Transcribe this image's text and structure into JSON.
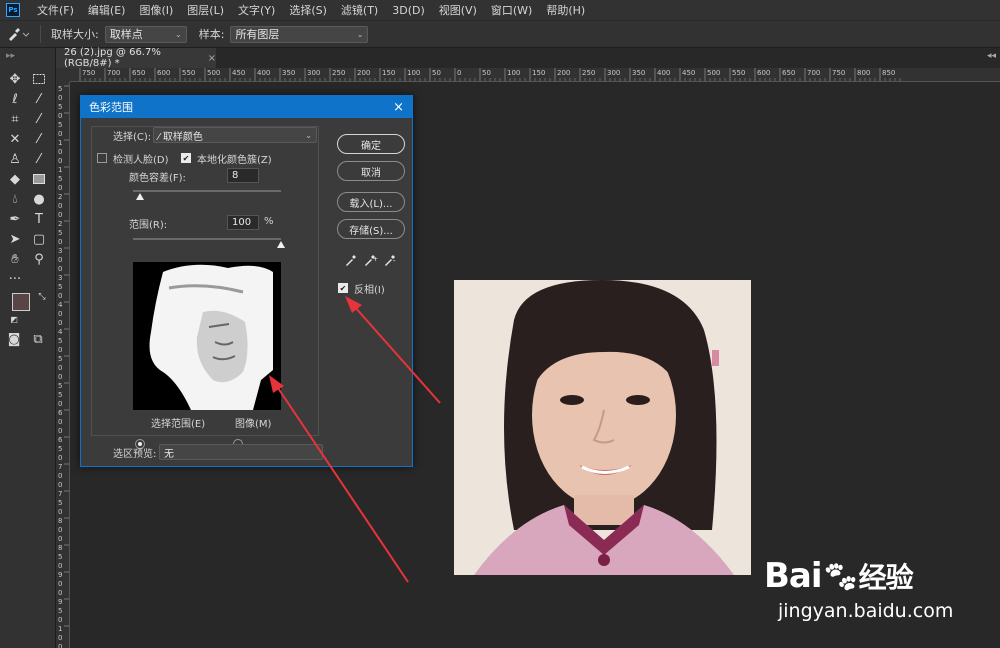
{
  "app": {
    "logo_text": "Ps"
  },
  "menu": [
    "文件(F)",
    "编辑(E)",
    "图像(I)",
    "图层(L)",
    "文字(Y)",
    "选择(S)",
    "滤镜(T)",
    "3D(D)",
    "视图(V)",
    "窗口(W)",
    "帮助(H)"
  ],
  "options": {
    "sample_size_label": "取样大小:",
    "sample_size_value": "取样点",
    "sample_label": "样本:",
    "sample_value": "所有图层"
  },
  "document": {
    "tab_title": "26 (2).jpg @ 66.7%(RGB/8#) *",
    "tab_close": "×"
  },
  "ruler": {
    "h_labels": [
      "750",
      "700",
      "650",
      "600",
      "550",
      "500",
      "450",
      "400",
      "350",
      "300",
      "250",
      "200",
      "150",
      "100",
      "50",
      "0",
      "50",
      "100",
      "150",
      "200",
      "250",
      "300",
      "350",
      "400",
      "450",
      "500",
      "550",
      "600",
      "650",
      "700",
      "750",
      "800",
      "850"
    ],
    "v_labels": [
      "5",
      "0",
      "5",
      "0",
      "5",
      "0",
      "1",
      "0",
      "0",
      "1",
      "5",
      "0",
      "2",
      "0",
      "0",
      "2",
      "5",
      "0",
      "3",
      "0",
      "0",
      "3",
      "5",
      "0",
      "4",
      "0",
      "0",
      "4",
      "5",
      "0",
      "5",
      "0",
      "0",
      "5",
      "5",
      "0",
      "6",
      "0",
      "0",
      "6",
      "5",
      "0",
      "7",
      "0",
      "0",
      "7",
      "5",
      "0",
      "8",
      "0",
      "0",
      "8",
      "5",
      "0",
      "9",
      "0",
      "0",
      "9",
      "5",
      "0",
      "1",
      "0",
      "0"
    ]
  },
  "dialog": {
    "title": "色彩范围",
    "close": "×",
    "select_label": "选择(C):",
    "select_value": "取样颜色",
    "detect_faces_label": "检测人脸(D)",
    "localized_label": "本地化颜色簇(Z)",
    "fuzziness_label": "颜色容差(F):",
    "fuzziness_value": "8",
    "fuzziness_level": 0.05,
    "range_label": "范围(R):",
    "range_value": "100",
    "range_unit": "%",
    "range_level": 1.0,
    "radio_selection": "选择范围(E)",
    "radio_image": "图像(M)",
    "selection_preview_label": "选区预览:",
    "selection_preview_value": "无",
    "ok": "确定",
    "cancel": "取消",
    "load": "载入(L)...",
    "save": "存储(S)...",
    "invert_label": "反相(I)",
    "invert_checked": true,
    "localized_checked": true,
    "detect_faces_checked": false
  },
  "watermark": {
    "brand": "Bai",
    "brand2": "经验",
    "url": "jingyan.baidu.com"
  },
  "colors": {
    "accent": "#0f74c9",
    "arrow": "#e8333a",
    "foreground": "#5a4546",
    "background": "#d8b8b4"
  }
}
